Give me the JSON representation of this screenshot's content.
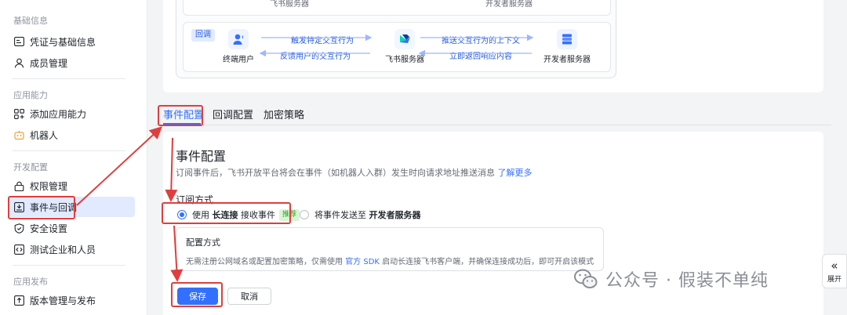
{
  "sidebar": {
    "sections": [
      {
        "title": "基础信息"
      },
      {
        "title": "应用能力"
      },
      {
        "title": "开发配置"
      },
      {
        "title": "应用发布"
      }
    ],
    "items": [
      {
        "label": "凭证与基础信息",
        "icon": "id-card-icon"
      },
      {
        "label": "成员管理",
        "icon": "user-icon"
      },
      {
        "label": "添加应用能力",
        "icon": "grid-plus-icon"
      },
      {
        "label": "机器人",
        "icon": "robot-icon"
      },
      {
        "label": "权限管理",
        "icon": "lock-icon"
      },
      {
        "label": "事件与回调",
        "icon": "event-icon"
      },
      {
        "label": "安全设置",
        "icon": "shield-icon"
      },
      {
        "label": "测试企业和人员",
        "icon": "code-icon"
      },
      {
        "label": "版本管理与发布",
        "icon": "upload-icon"
      }
    ]
  },
  "diagram": {
    "top_left_label": "飞书服务器",
    "top_right_label": "开发者服务器",
    "tag": "回调",
    "nodes": [
      "终端用户",
      "飞书服务器",
      "开发者服务器"
    ],
    "flows": [
      "触发特定交互行为",
      "反馈用户的交互行为",
      "推送交互行为的上下文",
      "立即返回响应内容"
    ]
  },
  "tabs": [
    "事件配置",
    "回调配置",
    "加密策略"
  ],
  "event": {
    "title": "事件配置",
    "desc": "订阅事件后，飞书开放平台将会在事件（如机器人入群）发生时向请求地址推送消息",
    "learn_more": "了解更多",
    "subscribe_label": "订阅方式",
    "option1_prefix": "使用",
    "option1_bold": "长连接",
    "option1_suffix": "接收事件",
    "option1_badge": "推荐",
    "option2_prefix": "将事件发送至",
    "option2_bold": "开发者服务器",
    "mode_title": "配置方式",
    "mode_desc_1": "无需注册公网域名或配置加密策略，仅需使用",
    "mode_desc_link": "官方 SDK",
    "mode_desc_2": "启动长连接飞书客户端，并确保连接成功后，即可开启该模式",
    "save": "保存",
    "cancel": "取消"
  },
  "watermark": "公众号 · 假装不单纯",
  "expand_label": "展开",
  "colors": {
    "accent": "#3370ff",
    "annotation": "#e03e3e",
    "active_bg": "#e1eaff"
  }
}
